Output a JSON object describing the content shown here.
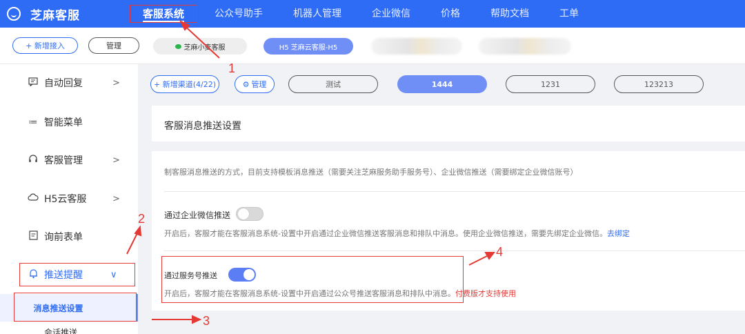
{
  "app": {
    "brand": "芝麻客服"
  },
  "topnav": {
    "items": [
      "客服系统",
      "公众号助手",
      "机器人管理",
      "企业微信",
      "价格",
      "帮助文档",
      "工单"
    ]
  },
  "subbar": {
    "add_label": "+ 新增接入",
    "manage_label": "管理",
    "channels": [
      "芝麻小麦客服",
      "H5 芝麻云客服-H5"
    ]
  },
  "sidebar": {
    "items": [
      {
        "label": "自动回复",
        "icon": "message-square-icon",
        "chevron": ">"
      },
      {
        "label": "智能菜单",
        "icon": "list-icon",
        "chevron": ""
      },
      {
        "label": "客服管理",
        "icon": "headset-icon",
        "chevron": ">"
      },
      {
        "label": "H5云客服",
        "icon": "cloud-icon",
        "chevron": ">"
      },
      {
        "label": "询前表单",
        "icon": "form-icon",
        "chevron": ""
      },
      {
        "label": "推送提醒",
        "icon": "bell-icon",
        "chevron": "∨"
      }
    ],
    "sub_active": "消息推送设置",
    "sub_next": "会话推送"
  },
  "content": {
    "tabs": {
      "add_channel": "+ 新增渠道(4/22)",
      "manage": "管理",
      "items": [
        "测试",
        "1444",
        "1231",
        "123213"
      ]
    },
    "panel_title": "客服消息推送设置",
    "intro": "制客服消息推送的方式，目前支持模板消息推送（需要关注芝麻服务助手服务号）、企业微信推送（需要绑定企业微信账号）",
    "option1": {
      "label": "通过企业微信推送",
      "enabled": false,
      "desc": "开启后，客服才能在客服消息系统-设置中开启通过企业微信推送客服消息和排队中消息。使用企业微信推送，需要先绑定企业微信。",
      "link": "去绑定"
    },
    "option2": {
      "label": "通过服务号推送",
      "enabled": true,
      "desc": "开启后，客服才能在客服消息系统-设置中开启通过公众号推送客服消息和排队中消息。",
      "note": "付费版才支持使用"
    }
  },
  "annotations": [
    "1",
    "2",
    "3",
    "4"
  ],
  "colors": {
    "primary": "#2f6cf6",
    "accent_tab": "#6f8ff7",
    "annotation": "#e53935"
  }
}
